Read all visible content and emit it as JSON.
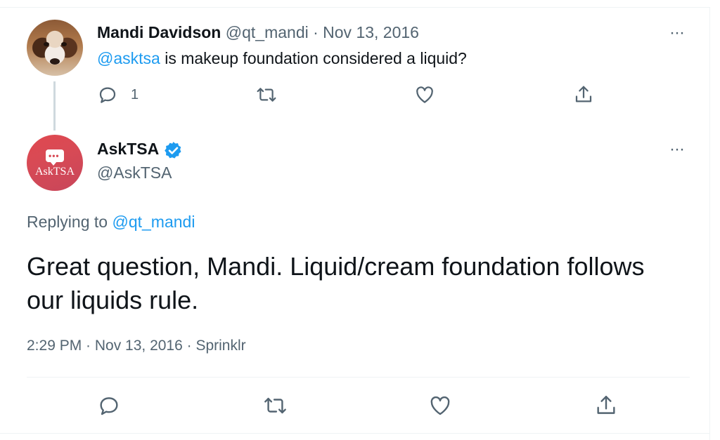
{
  "parent_tweet": {
    "display_name": "Mandi Davidson",
    "meta": " @qt_mandi · Nov 13, 2016",
    "mention": "@asktsa",
    "text": " is makeup foundation considered a liquid?",
    "reply_count": "1",
    "more_label": "···"
  },
  "reply_tweet": {
    "display_name": "AskTSA",
    "handle": "@AskTSA",
    "avatar_text": "AskTSA",
    "more_label": "···",
    "replying_prefix": "Replying to ",
    "replying_mention": "@qt_mandi",
    "text": "Great question, Mandi. Liquid/cream foundation follows our liquids rule.",
    "timestamp": "2:29 PM · Nov 13, 2016 · Sprinklr"
  },
  "colors": {
    "link": "#1d9bf0",
    "muted": "#536471",
    "text": "#0f1419",
    "verified": "#1d9bf0"
  },
  "icons": [
    "reply-icon",
    "retweet-icon",
    "like-icon",
    "share-icon",
    "verified-badge-icon",
    "more-icon"
  ]
}
